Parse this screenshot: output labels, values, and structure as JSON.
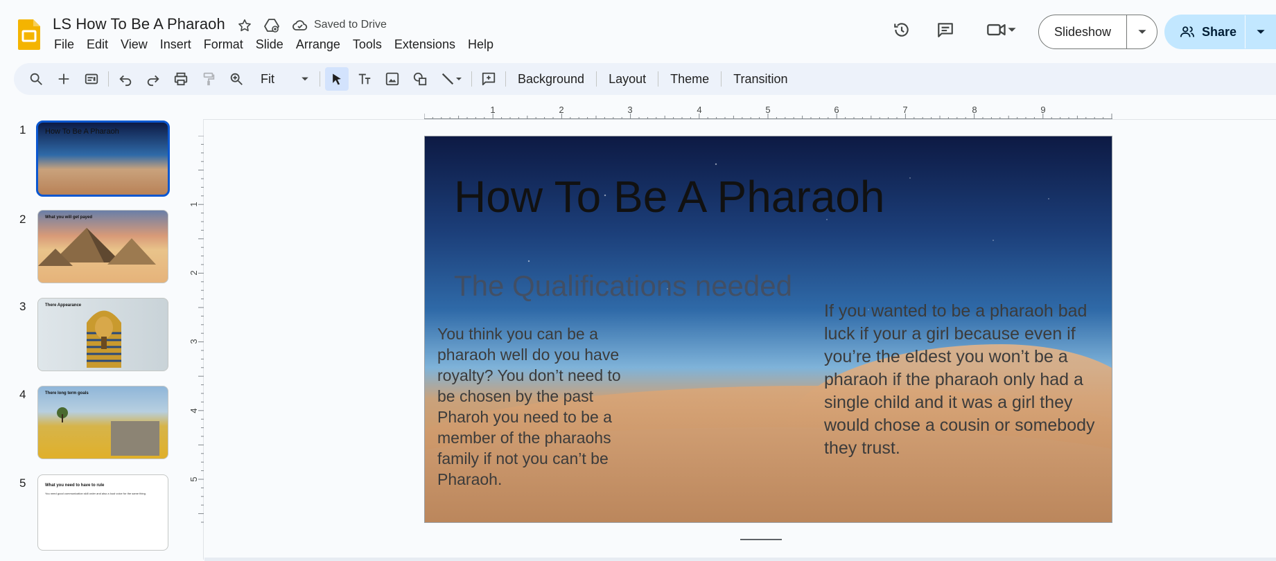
{
  "header": {
    "doc_title": "LS How To Be A Pharaoh",
    "saved_status": "Saved to Drive",
    "menu": [
      "File",
      "Edit",
      "View",
      "Insert",
      "Format",
      "Slide",
      "Arrange",
      "Tools",
      "Extensions",
      "Help"
    ],
    "slideshow_label": "Slideshow",
    "share_label": "Share"
  },
  "toolbar": {
    "zoom": "Fit",
    "background_label": "Background",
    "layout_label": "Layout",
    "theme_label": "Theme",
    "transition_label": "Transition"
  },
  "filmstrip": {
    "slides": [
      {
        "num": "1",
        "title": "How To Be A Pharaoh"
      },
      {
        "num": "2",
        "title": "What you will get payed"
      },
      {
        "num": "3",
        "title": "There Appearance"
      },
      {
        "num": "4",
        "title": "There long term goals"
      },
      {
        "num": "5",
        "title": "What you need to have to rule",
        "text": "You need good communication skill order and also a loud voice for the same thing."
      }
    ]
  },
  "rulers": {
    "top_ticks": [
      "1",
      "2",
      "3",
      "4",
      "5",
      "6",
      "7",
      "8",
      "9"
    ],
    "left_ticks": [
      "1",
      "2",
      "3",
      "4",
      "5"
    ]
  },
  "slide": {
    "title": "How To Be A Pharaoh",
    "subtitle": "The Qualifications needed",
    "body_left": "You think you can be a pharaoh well do you have royalty? You don’t need to be chosen by the past Pharoh you need to be a member of the pharaohs family if not you can’t be Pharaoh.",
    "body_right": "If you wanted to be a pharaoh bad luck if your a girl because even if you’re the eldest you won’t be a pharaoh if the pharaoh only had a single child and it was a girl they would chose a cousin or somebody they trust."
  },
  "colors": {
    "accent_blue": "#0b57d0",
    "share_bg": "#c2e7ff",
    "toolbar_bg": "#edf2fa",
    "logo_yellow": "#f4b400"
  }
}
